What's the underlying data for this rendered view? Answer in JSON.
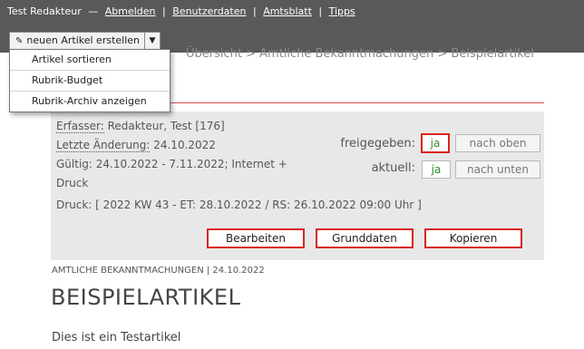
{
  "topbar": {
    "user": "Test Redakteur",
    "dash": "—",
    "links": [
      "Abmelden",
      "Benutzerdaten",
      "Amtsblatt",
      "Tipps"
    ],
    "separator": "|"
  },
  "new_article": {
    "label": "neuen Artikel erstellen",
    "pen_icon": "✎",
    "arrow_icon": "▼",
    "menu": [
      "Artikel sortieren",
      "Rubrik-Budget",
      "Rubrik-Archiv anzeigen"
    ]
  },
  "breadcrumb": "Übersicht > Amtliche Bekanntmachungen > Beispielartikel",
  "meta": {
    "erfasser_label": "Erfasser:",
    "erfasser_value": "Redakteur, Test [176]",
    "aenderung_label": "Letzte Änderung:",
    "aenderung_value": "24.10.2022",
    "gueltig_line1": "Gültig: 24.10.2022 - 7.11.2022; Internet +",
    "gueltig_line2": "Druck",
    "druck": "Druck: [ 2022 KW 43 - ET: 28.10.2022 / RS: 26.10.2022 09:00 Uhr ]",
    "freigegeben_label": "freigegeben:",
    "freigegeben_value": "ja",
    "aktuell_label": "aktuell:",
    "aktuell_value": "ja",
    "nach_oben": "nach oben",
    "nach_unten": "nach unten"
  },
  "actions": {
    "bearbeiten": "Bearbeiten",
    "grunddaten": "Grunddaten",
    "kopieren": "Kopieren"
  },
  "article": {
    "section": "AMTLICHE BEKANNTMACHUNGEN | 24.10.2022",
    "title": "BEISPIELARTIKEL",
    "body": "Dies ist ein Testartikel"
  },
  "colors": {
    "topbar": "#595959",
    "accent_red": "#d9241c",
    "value_green": "#2e8b2e",
    "metabox": "#e8e8e8"
  }
}
